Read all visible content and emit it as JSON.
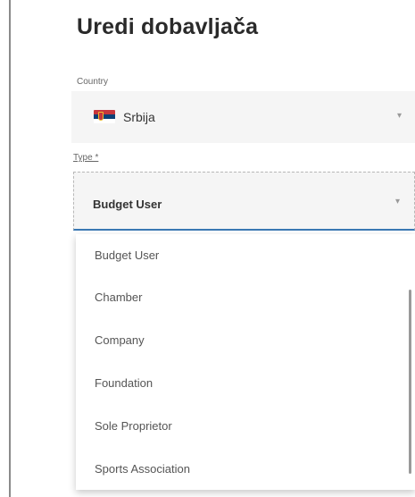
{
  "page": {
    "title": "Uredi dobavljača"
  },
  "country": {
    "label": "Country",
    "value": "Srbija",
    "flag_icon": "serbia-flag",
    "chevron": "▾"
  },
  "type": {
    "label": "Type *",
    "value": "Budget User",
    "chevron": "▾",
    "accent_color": "#3a78b4",
    "options": [
      "Budget User",
      "Chamber",
      "Company",
      "Foundation",
      "Sole Proprietor",
      "Sports Association"
    ]
  }
}
